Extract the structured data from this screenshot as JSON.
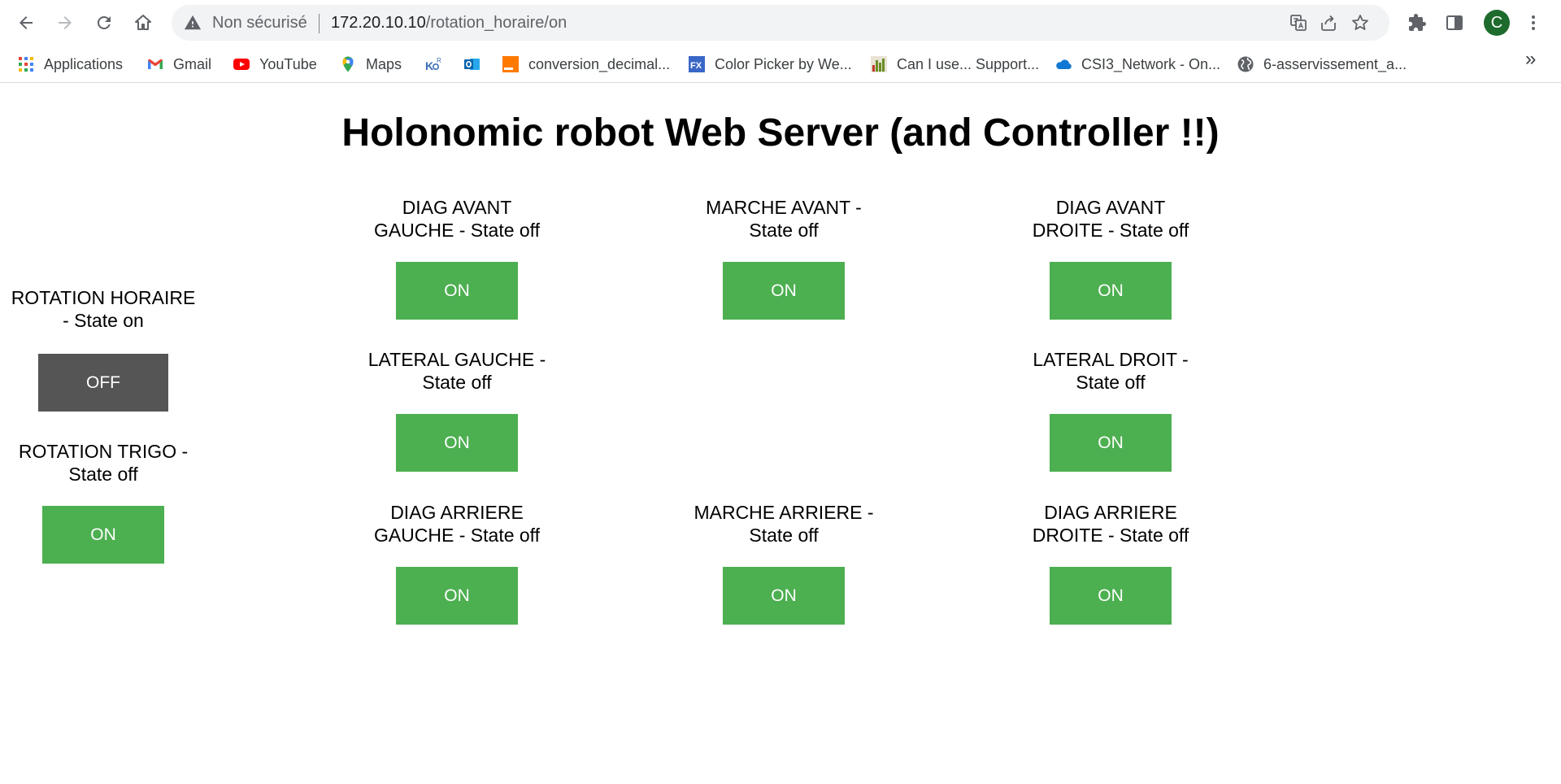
{
  "browser": {
    "security_label": "Non sécurisé",
    "url_host": "172.20.10.10",
    "url_path": "/rotation_horaire/on",
    "profile_initial": "C",
    "bookmarks": [
      {
        "label": "Applications",
        "icon": "apps-grid-icon"
      },
      {
        "label": "Gmail",
        "icon": "gmail-icon"
      },
      {
        "label": "YouTube",
        "icon": "youtube-icon"
      },
      {
        "label": "Maps",
        "icon": "maps-icon"
      },
      {
        "label": "",
        "icon": "kdr-icon"
      },
      {
        "label": "",
        "icon": "outlook-icon"
      },
      {
        "label": "conversion_decimal...",
        "icon": "orange-icon"
      },
      {
        "label": "Color Picker by We...",
        "icon": "fx-icon"
      },
      {
        "label": "Can I use... Support...",
        "icon": "caniuse-icon"
      },
      {
        "label": "CSI3_Network - On...",
        "icon": "onedrive-icon"
      },
      {
        "label": "6-asservissement_a...",
        "icon": "globe-icon"
      }
    ],
    "more_label": "»"
  },
  "colors": {
    "on_button": "#4caf50",
    "off_button": "#555555"
  },
  "page": {
    "title": "Holonomic robot Web Server (and Controller !!)",
    "controls": {
      "diag_avant_gauche": {
        "label": "DIAG AVANT GAUCHE - State off",
        "button": "ON"
      },
      "marche_avant": {
        "label": "MARCHE AVANT - State off",
        "button": "ON"
      },
      "diag_avant_droite": {
        "label": "DIAG AVANT DROITE - State off",
        "button": "ON"
      },
      "rotation_horaire": {
        "label": "ROTATION HORAIRE - State on",
        "button": "OFF"
      },
      "lateral_gauche": {
        "label": "LATERAL GAUCHE - State off",
        "button": "ON"
      },
      "lateral_droit": {
        "label": "LATERAL DROIT - State off",
        "button": "ON"
      },
      "rotation_trigo": {
        "label": "ROTATION TRIGO - State off",
        "button": "ON"
      },
      "diag_arriere_gauche": {
        "label": "DIAG ARRIERE GAUCHE - State off",
        "button": "ON"
      },
      "marche_arriere": {
        "label": "MARCHE ARRIERE - State off",
        "button": "ON"
      },
      "diag_arriere_droite": {
        "label": "DIAG ARRIERE DROITE - State off",
        "button": "ON"
      }
    }
  }
}
